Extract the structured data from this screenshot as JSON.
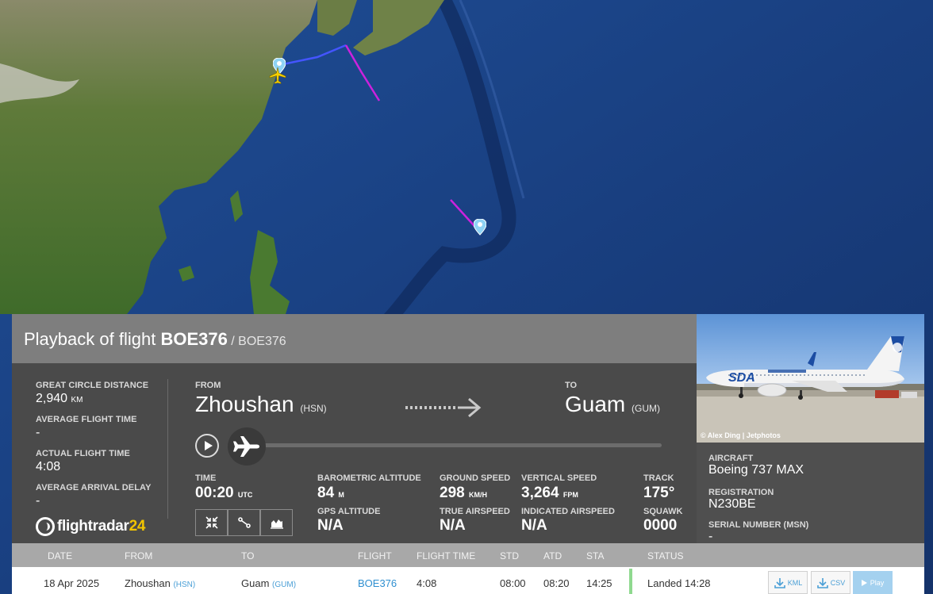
{
  "header": {
    "title_prefix": "Playback of flight ",
    "flight": "BOE376",
    "subtitle": " / BOE376"
  },
  "stats": {
    "great_circle_label": "GREAT CIRCLE DISTANCE",
    "great_circle_value": "2,940",
    "great_circle_unit": "KM",
    "avg_flight_time_label": "AVERAGE FLIGHT TIME",
    "avg_flight_time_value": "-",
    "actual_flight_time_label": "ACTUAL FLIGHT TIME",
    "actual_flight_time_value": "4:08",
    "avg_arrival_delay_label": "AVERAGE ARRIVAL DELAY",
    "avg_arrival_delay_value": "-"
  },
  "logo": {
    "text": "flightradar",
    "num": "24"
  },
  "route": {
    "from_label": "FROM",
    "from_city": "Zhoushan",
    "from_code": "(HSN)",
    "to_label": "TO",
    "to_city": "Guam",
    "to_code": "(GUM)"
  },
  "metrics": {
    "time_label": "TIME",
    "time_value": "00:20",
    "time_unit": "UTC",
    "baro_alt_label": "BAROMETRIC ALTITUDE",
    "baro_alt_value": "84",
    "baro_alt_unit": "M",
    "gps_alt_label": "GPS ALTITUDE",
    "gps_alt_value": "N/A",
    "ground_speed_label": "GROUND SPEED",
    "ground_speed_value": "298",
    "ground_speed_unit": "KM/H",
    "true_airspeed_label": "TRUE AIRSPEED",
    "true_airspeed_value": "N/A",
    "vertical_speed_label": "VERTICAL SPEED",
    "vertical_speed_value": "3,264",
    "vertical_speed_unit": "FPM",
    "indicated_airspeed_label": "INDICATED AIRSPEED",
    "indicated_airspeed_value": "N/A",
    "track_label": "TRACK",
    "track_value": "175°",
    "squawk_label": "SQUAWK",
    "squawk_value": "0000"
  },
  "aircraft": {
    "photo_credit": "© Alex Ding | Jetphotos",
    "livery_text": "SDA",
    "aircraft_label": "AIRCRAFT",
    "aircraft_value": "Boeing 737 MAX",
    "registration_label": "REGISTRATION",
    "registration_value": "N230BE",
    "serial_label": "SERIAL NUMBER (MSN)",
    "serial_value": "-"
  },
  "table": {
    "headers": [
      "DATE",
      "FROM",
      "TO",
      "FLIGHT",
      "FLIGHT TIME",
      "STD",
      "ATD",
      "STA",
      "STATUS"
    ],
    "row": {
      "date": "18 Apr 2025",
      "from": "Zhoushan",
      "from_code": "(HSN)",
      "to": "Guam",
      "to_code": "(GUM)",
      "flight": "BOE376",
      "flight_time": "4:08",
      "std": "08:00",
      "atd": "08:20",
      "sta": "14:25",
      "status": "Landed 14:28",
      "kml": "KML",
      "csv": "CSV",
      "play": "Play"
    }
  },
  "colors": {
    "track_blue": "#3355ff",
    "track_purple": "#cc22dd",
    "accent": "#3f9fe0",
    "logo_yellow": "#f2c500"
  }
}
